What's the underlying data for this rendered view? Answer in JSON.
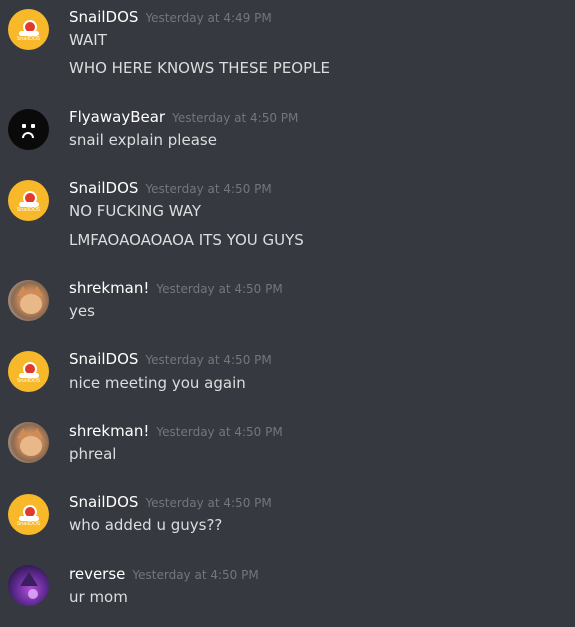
{
  "colors": {
    "background": "#36393f",
    "username": "#ffffff",
    "timestamp": "#72767d",
    "message_text": "#dcddde"
  },
  "messages": [
    {
      "author": "SnailDOS",
      "avatar": "snail-avatar-icon",
      "avatar_text": "SnailDOS",
      "timestamp": "Yesterday at 4:49 PM",
      "lines": [
        "WAIT",
        "WHO HERE KNOWS THESE PEOPLE"
      ]
    },
    {
      "author": "FlyawayBear",
      "avatar": "sad-face-avatar-icon",
      "timestamp": "Yesterday at 4:50 PM",
      "lines": [
        "snail explain please"
      ]
    },
    {
      "author": "SnailDOS",
      "avatar": "snail-avatar-icon",
      "avatar_text": "SnailDOS",
      "timestamp": "Yesterday at 4:50 PM",
      "lines": [
        "NO FUCKING WAY",
        "LMFAOAOAOAOA ITS YOU GUYS"
      ]
    },
    {
      "author": "shrekman!",
      "avatar": "cat-avatar-icon",
      "timestamp": "Yesterday at 4:50 PM",
      "lines": [
        "yes"
      ]
    },
    {
      "author": "SnailDOS",
      "avatar": "snail-avatar-icon",
      "avatar_text": "SnailDOS",
      "timestamp": "Yesterday at 4:50 PM",
      "lines": [
        "nice meeting you again"
      ]
    },
    {
      "author": "shrekman!",
      "avatar": "cat-avatar-icon",
      "timestamp": "Yesterday at 4:50 PM",
      "lines": [
        "phreal"
      ]
    },
    {
      "author": "SnailDOS",
      "avatar": "snail-avatar-icon",
      "avatar_text": "SnailDOS",
      "timestamp": "Yesterday at 4:50 PM",
      "lines": [
        "who added u guys??"
      ]
    },
    {
      "author": "reverse",
      "avatar": "wizard-avatar-icon",
      "timestamp": "Yesterday at 4:50 PM",
      "lines": [
        "ur mom"
      ]
    }
  ]
}
